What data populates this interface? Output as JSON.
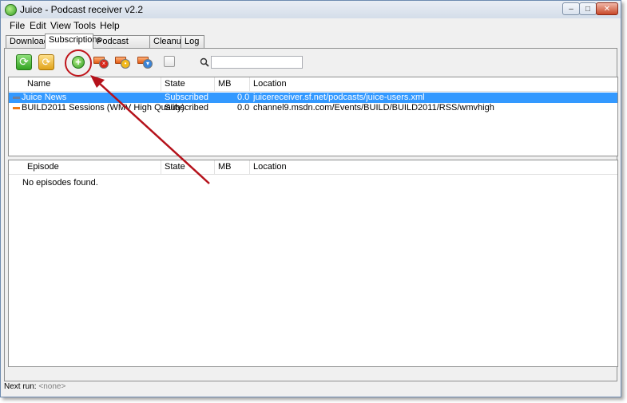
{
  "window": {
    "title": "Juice - Podcast receiver v2.2",
    "min_glyph": "–",
    "max_glyph": "□",
    "close_glyph": "✕"
  },
  "menu": [
    "File",
    "Edit",
    "View",
    "Tools",
    "Help"
  ],
  "tabs": [
    "Downloads",
    "Subscriptions",
    "Podcast directory",
    "Cleanup",
    "Log"
  ],
  "active_tab": "Subscriptions",
  "toolbar": {
    "buttons": [
      {
        "name": "check-all-icon",
        "glyph": "⟳"
      },
      {
        "name": "check-selected-icon",
        "glyph": "⟳"
      },
      {
        "name": "add-feed-icon",
        "glyph": "+"
      },
      {
        "name": "delete-feed-icon",
        "glyph": "×"
      },
      {
        "name": "feed-properties-icon",
        "glyph": "•"
      },
      {
        "name": "update-feed-icon",
        "glyph": "▾"
      },
      {
        "name": "scheduler-icon",
        "glyph": ""
      }
    ],
    "search_value": ""
  },
  "subscriptions": {
    "columns": [
      "Name",
      "State",
      "MB",
      "Location"
    ],
    "rows": [
      {
        "name": "Juice News",
        "state": "Subscribed",
        "mb": "0.0",
        "location": "juicereceiver.sf.net/podcasts/juice-users.xml",
        "selected": true,
        "icon_color": "#6c7f9e"
      },
      {
        "name": "BUILD2011 Sessions (WMV High Quality)",
        "state": "Subscribed",
        "mb": "0.0",
        "location": "channel9.msdn.com/Events/BUILD/BUILD2011/RSS/wmvhigh",
        "selected": false,
        "icon_color": "#f07a14"
      }
    ]
  },
  "episodes": {
    "columns": [
      "Episode",
      "State",
      "MB",
      "Location"
    ],
    "empty_message": "No episodes found."
  },
  "status": {
    "label": "Next run:",
    "value": "<none>"
  },
  "annotation_color": "#c0161c"
}
